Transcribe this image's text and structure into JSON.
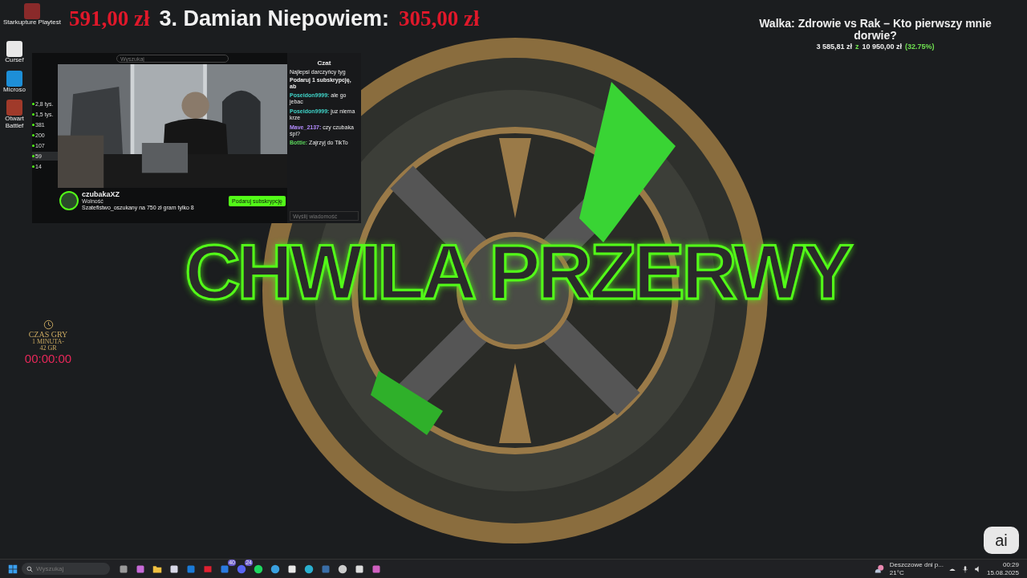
{
  "ticker": {
    "prev_amount": "591,00 zł",
    "entry": "3. Damian Niepowiem:",
    "amount": "305,00 zł"
  },
  "desktop_icons": [
    {
      "label": "Starkupture Playtest",
      "color": "#8a2a2a"
    },
    {
      "label": "Cursef",
      "color": "#e8e8e8"
    },
    {
      "label": "Microso",
      "color": "#1d8fd8"
    },
    {
      "label": "Otwart Battlef",
      "color": "#a03a2a"
    }
  ],
  "stream": {
    "search": {
      "placeholder": "Wyszukaj"
    },
    "viewers": [
      {
        "count": "2,8 tys.",
        "selected": false
      },
      {
        "count": "1,5 tys.",
        "selected": false
      },
      {
        "count": "381",
        "selected": false
      },
      {
        "count": "200",
        "selected": false
      },
      {
        "count": "107",
        "selected": false
      },
      {
        "count": "59",
        "selected": true
      },
      {
        "count": "14",
        "selected": false
      }
    ],
    "channel": "czubakaXZ",
    "category": "Wolność",
    "stream_title": "Szatefistwo_oszukany na  750 zł gram tylko 8",
    "subscribe": "Podaruj subskrypcję",
    "chat": {
      "title": "Czat",
      "top_label": "Najlepsi darczyńcy tyg",
      "gift_prompt": "Podaruj 1 subskrypcję, ab",
      "messages": [
        {
          "user": "Poseidon9999:",
          "text": "ale go jebac",
          "color": "#3fd4c8"
        },
        {
          "user": "Poseidon9999:",
          "text": "juz niema krze",
          "color": "#3fd4c8"
        },
        {
          "user": "Mave_2137:",
          "text": "czy czubaka śpi?",
          "color": "#b48cff"
        },
        {
          "user": "Bottie:",
          "text": "Zajrzyj do TikTo",
          "color": "#5ad45a"
        }
      ],
      "input": {
        "placeholder": "Wyślij wiadomość"
      }
    }
  },
  "goal": {
    "title": "Walka: Zdrowie vs Rak – Kto pierwszy mnie dorwie?",
    "raised": "3 585,81 zł",
    "of": "z",
    "target": "10 950,00 zł",
    "percent": "(32.75%)"
  },
  "banner": "CHWILA PRZERWY",
  "timer": {
    "label": "CZAS GRY",
    "rate": "1 MINUTA-\n42 GR",
    "time": "00:00:00"
  },
  "ai_button": "ai",
  "taskbar": {
    "search": {
      "placeholder": "Wyszukaj"
    },
    "apps": [
      {
        "kind": "stack",
        "color": "#9a9a9a"
      },
      {
        "kind": "copilot",
        "color": "#c86ad8"
      },
      {
        "kind": "folder",
        "color": "#f0c040"
      },
      {
        "kind": "store",
        "color": "#d8d8e8"
      },
      {
        "kind": "mail",
        "color": "#1a7ad8"
      },
      {
        "kind": "play",
        "color": "#e02030"
      },
      {
        "kind": "chat",
        "color": "#2a7ae0",
        "badge": "40"
      },
      {
        "kind": "discord",
        "color": "#5865f2",
        "badge": "24"
      },
      {
        "kind": "music",
        "color": "#1ed760"
      },
      {
        "kind": "hub",
        "color": "#3aa0e0"
      },
      {
        "kind": "notes",
        "color": "#e8e8e8"
      },
      {
        "kind": "browser",
        "color": "#2ab0d0"
      },
      {
        "kind": "steam",
        "color": "#3a6ea8"
      },
      {
        "kind": "record",
        "color": "#cccccc"
      },
      {
        "kind": "tool",
        "color": "#dddddd"
      },
      {
        "kind": "game",
        "color": "#d060c0"
      }
    ],
    "weather": {
      "title": "Deszczowe dni p...",
      "temp": "21°C"
    },
    "time": "00:29",
    "date": "15.08.2025"
  }
}
